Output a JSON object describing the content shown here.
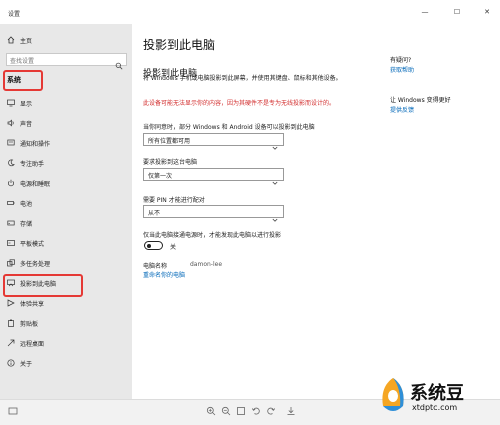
{
  "window": {
    "title": "设置",
    "controls": {
      "minimize": "—",
      "maximize": "☐",
      "close": "✕"
    }
  },
  "sidebar": {
    "home": "主页",
    "search_placeholder": "查找设置",
    "section": "系统",
    "items": [
      {
        "label": "显示",
        "icon": "monitor-icon"
      },
      {
        "label": "声音",
        "icon": "speaker-icon"
      },
      {
        "label": "通知和操作",
        "icon": "notification-icon"
      },
      {
        "label": "专注助手",
        "icon": "moon-icon"
      },
      {
        "label": "电源和睡眠",
        "icon": "power-icon"
      },
      {
        "label": "电池",
        "icon": "battery-icon"
      },
      {
        "label": "存储",
        "icon": "storage-icon"
      },
      {
        "label": "平板模式",
        "icon": "tablet-icon"
      },
      {
        "label": "多任务处理",
        "icon": "multitask-icon"
      },
      {
        "label": "投影到此电脑",
        "icon": "project-icon"
      },
      {
        "label": "体验共享",
        "icon": "share-icon"
      },
      {
        "label": "剪贴板",
        "icon": "clipboard-icon"
      },
      {
        "label": "远程桌面",
        "icon": "remote-desktop-icon"
      },
      {
        "label": "关于",
        "icon": "info-icon"
      }
    ]
  },
  "content": {
    "title": "投影到此电脑",
    "subtitle": "投影到此电脑",
    "description": "将 Windows 手机或电脑投影到此屏幕，并使用其键盘、鼠标和其他设备。",
    "warning": "此设备可能无法显示你的内容，因为其硬件不是专为无线投影而设计的。",
    "setting1": {
      "label": "当你同意时，部分 Windows 和 Android 设备可以投影到此电脑",
      "value": "所有位置都可用"
    },
    "setting2": {
      "label": "要求投影到这台电脑",
      "value": "仅第一次"
    },
    "setting3": {
      "label": "需要 PIN 才能进行配对",
      "value": "从不"
    },
    "setting4": {
      "label": "仅当此电脑接通电源时，才能发现此电脑以进行投影",
      "toggle_state": "关"
    },
    "pc_name": {
      "label": "电脑名称",
      "value": "damon-lee"
    },
    "rename_link": "重命名你的电脑"
  },
  "aside": {
    "question1": "有疑问?",
    "link1": "获取帮助",
    "question2": "让 Windows 变得更好",
    "link2": "提供反馈"
  },
  "watermark": {
    "name": "系统豆",
    "url": "xtdptc.com"
  },
  "colors": {
    "accent": "#0067b8",
    "warning": "#d32f2f",
    "highlight": "#e53935",
    "sidebar_bg": "#e8e8e8"
  }
}
